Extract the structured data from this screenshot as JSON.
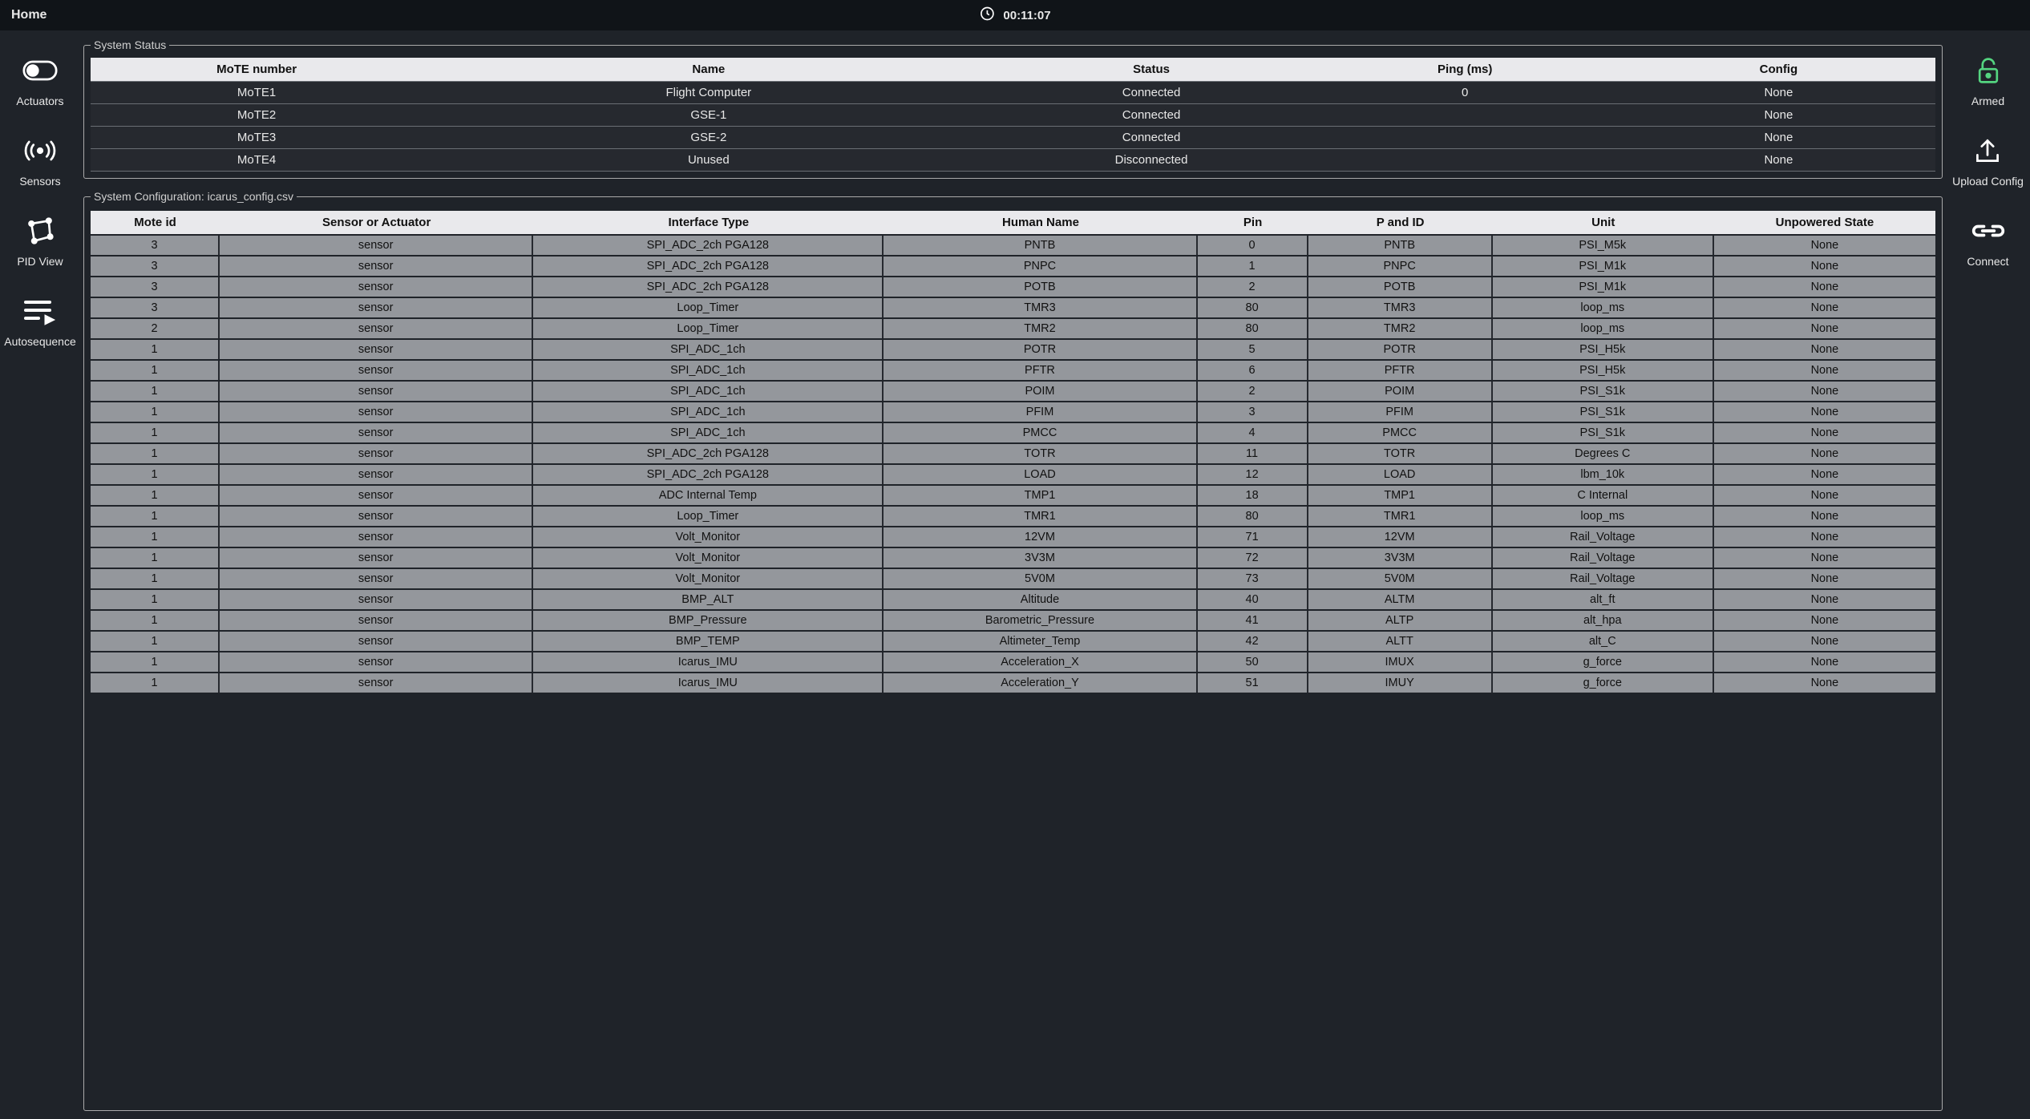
{
  "header": {
    "home": "Home",
    "time": "00:11:07"
  },
  "sidebar_left": {
    "items": [
      {
        "id": "actuators",
        "label": "Actuators",
        "icon": "toggle"
      },
      {
        "id": "sensors",
        "label": "Sensors",
        "icon": "broadcast"
      },
      {
        "id": "pid-view",
        "label": "PID View",
        "icon": "polygon"
      },
      {
        "id": "autosequence",
        "label": "Autosequence",
        "icon": "playlist"
      }
    ]
  },
  "sidebar_right": {
    "items": [
      {
        "id": "armed",
        "label": "Armed",
        "icon": "lock-open",
        "accent": "green"
      },
      {
        "id": "upload-config",
        "label": "Upload Config",
        "icon": "upload"
      },
      {
        "id": "connect",
        "label": "Connect",
        "icon": "link"
      }
    ]
  },
  "system_status": {
    "legend": "System Status",
    "columns": [
      "MoTE number",
      "Name",
      "Status",
      "Ping (ms)",
      "Config"
    ],
    "rows": [
      {
        "mote": "MoTE1",
        "name": "Flight Computer",
        "status": "Connected",
        "status_ok": true,
        "ping": "0",
        "config": "None"
      },
      {
        "mote": "MoTE2",
        "name": "GSE-1",
        "status": "Connected",
        "status_ok": true,
        "ping": "",
        "config": "None"
      },
      {
        "mote": "MoTE3",
        "name": "GSE-2",
        "status": "Connected",
        "status_ok": true,
        "ping": "",
        "config": "None"
      },
      {
        "mote": "MoTE4",
        "name": "Unused",
        "status": "Disconnected",
        "status_ok": false,
        "ping": "",
        "config": "None"
      }
    ]
  },
  "system_config": {
    "legend": "System Configuration: icarus_config.csv",
    "columns": [
      "Mote id",
      "Sensor or Actuator",
      "Interface Type",
      "Human Name",
      "Pin",
      "P and ID",
      "Unit",
      "Unpowered State"
    ],
    "rows": [
      {
        "mote": "3",
        "kind": "sensor",
        "iface": "SPI_ADC_2ch PGA128",
        "human": "PNTB",
        "pin": "0",
        "pid": "PNTB",
        "unit": "PSI_M5k",
        "unpow": "None"
      },
      {
        "mote": "3",
        "kind": "sensor",
        "iface": "SPI_ADC_2ch PGA128",
        "human": "PNPC",
        "pin": "1",
        "pid": "PNPC",
        "unit": "PSI_M1k",
        "unpow": "None"
      },
      {
        "mote": "3",
        "kind": "sensor",
        "iface": "SPI_ADC_2ch PGA128",
        "human": "POTB",
        "pin": "2",
        "pid": "POTB",
        "unit": "PSI_M1k",
        "unpow": "None"
      },
      {
        "mote": "3",
        "kind": "sensor",
        "iface": "Loop_Timer",
        "human": "TMR3",
        "pin": "80",
        "pid": "TMR3",
        "unit": "loop_ms",
        "unpow": "None"
      },
      {
        "mote": "2",
        "kind": "sensor",
        "iface": "Loop_Timer",
        "human": "TMR2",
        "pin": "80",
        "pid": "TMR2",
        "unit": "loop_ms",
        "unpow": "None"
      },
      {
        "mote": "1",
        "kind": "sensor",
        "iface": "SPI_ADC_1ch",
        "human": "POTR",
        "pin": "5",
        "pid": "POTR",
        "unit": "PSI_H5k",
        "unpow": "None"
      },
      {
        "mote": "1",
        "kind": "sensor",
        "iface": "SPI_ADC_1ch",
        "human": "PFTR",
        "pin": "6",
        "pid": "PFTR",
        "unit": "PSI_H5k",
        "unpow": "None"
      },
      {
        "mote": "1",
        "kind": "sensor",
        "iface": "SPI_ADC_1ch",
        "human": "POIM",
        "pin": "2",
        "pid": "POIM",
        "unit": "PSI_S1k",
        "unpow": "None"
      },
      {
        "mote": "1",
        "kind": "sensor",
        "iface": "SPI_ADC_1ch",
        "human": "PFIM",
        "pin": "3",
        "pid": "PFIM",
        "unit": "PSI_S1k",
        "unpow": "None"
      },
      {
        "mote": "1",
        "kind": "sensor",
        "iface": "SPI_ADC_1ch",
        "human": "PMCC",
        "pin": "4",
        "pid": "PMCC",
        "unit": "PSI_S1k",
        "unpow": "None"
      },
      {
        "mote": "1",
        "kind": "sensor",
        "iface": "SPI_ADC_2ch PGA128",
        "human": "TOTR",
        "pin": "11",
        "pid": "TOTR",
        "unit": "Degrees C",
        "unpow": "None"
      },
      {
        "mote": "1",
        "kind": "sensor",
        "iface": "SPI_ADC_2ch PGA128",
        "human": "LOAD",
        "pin": "12",
        "pid": "LOAD",
        "unit": "lbm_10k",
        "unpow": "None"
      },
      {
        "mote": "1",
        "kind": "sensor",
        "iface": "ADC Internal Temp",
        "human": "TMP1",
        "pin": "18",
        "pid": "TMP1",
        "unit": "C Internal",
        "unpow": "None"
      },
      {
        "mote": "1",
        "kind": "sensor",
        "iface": "Loop_Timer",
        "human": "TMR1",
        "pin": "80",
        "pid": "TMR1",
        "unit": "loop_ms",
        "unpow": "None"
      },
      {
        "mote": "1",
        "kind": "sensor",
        "iface": "Volt_Monitor",
        "human": "12VM",
        "pin": "71",
        "pid": "12VM",
        "unit": "Rail_Voltage",
        "unpow": "None"
      },
      {
        "mote": "1",
        "kind": "sensor",
        "iface": "Volt_Monitor",
        "human": "3V3M",
        "pin": "72",
        "pid": "3V3M",
        "unit": "Rail_Voltage",
        "unpow": "None"
      },
      {
        "mote": "1",
        "kind": "sensor",
        "iface": "Volt_Monitor",
        "human": "5V0M",
        "pin": "73",
        "pid": "5V0M",
        "unit": "Rail_Voltage",
        "unpow": "None"
      },
      {
        "mote": "1",
        "kind": "sensor",
        "iface": "BMP_ALT",
        "human": "Altitude",
        "pin": "40",
        "pid": "ALTM",
        "unit": "alt_ft",
        "unpow": "None"
      },
      {
        "mote": "1",
        "kind": "sensor",
        "iface": "BMP_Pressure",
        "human": "Barometric_Pressure",
        "pin": "41",
        "pid": "ALTP",
        "unit": "alt_hpa",
        "unpow": "None"
      },
      {
        "mote": "1",
        "kind": "sensor",
        "iface": "BMP_TEMP",
        "human": "Altimeter_Temp",
        "pin": "42",
        "pid": "ALTT",
        "unit": "alt_C",
        "unpow": "None"
      },
      {
        "mote": "1",
        "kind": "sensor",
        "iface": "Icarus_IMU",
        "human": "Acceleration_X",
        "pin": "50",
        "pid": "IMUX",
        "unit": "g_force",
        "unpow": "None"
      },
      {
        "mote": "1",
        "kind": "sensor",
        "iface": "Icarus_IMU",
        "human": "Acceleration_Y",
        "pin": "51",
        "pid": "IMUY",
        "unit": "g_force",
        "unpow": "None"
      }
    ]
  }
}
